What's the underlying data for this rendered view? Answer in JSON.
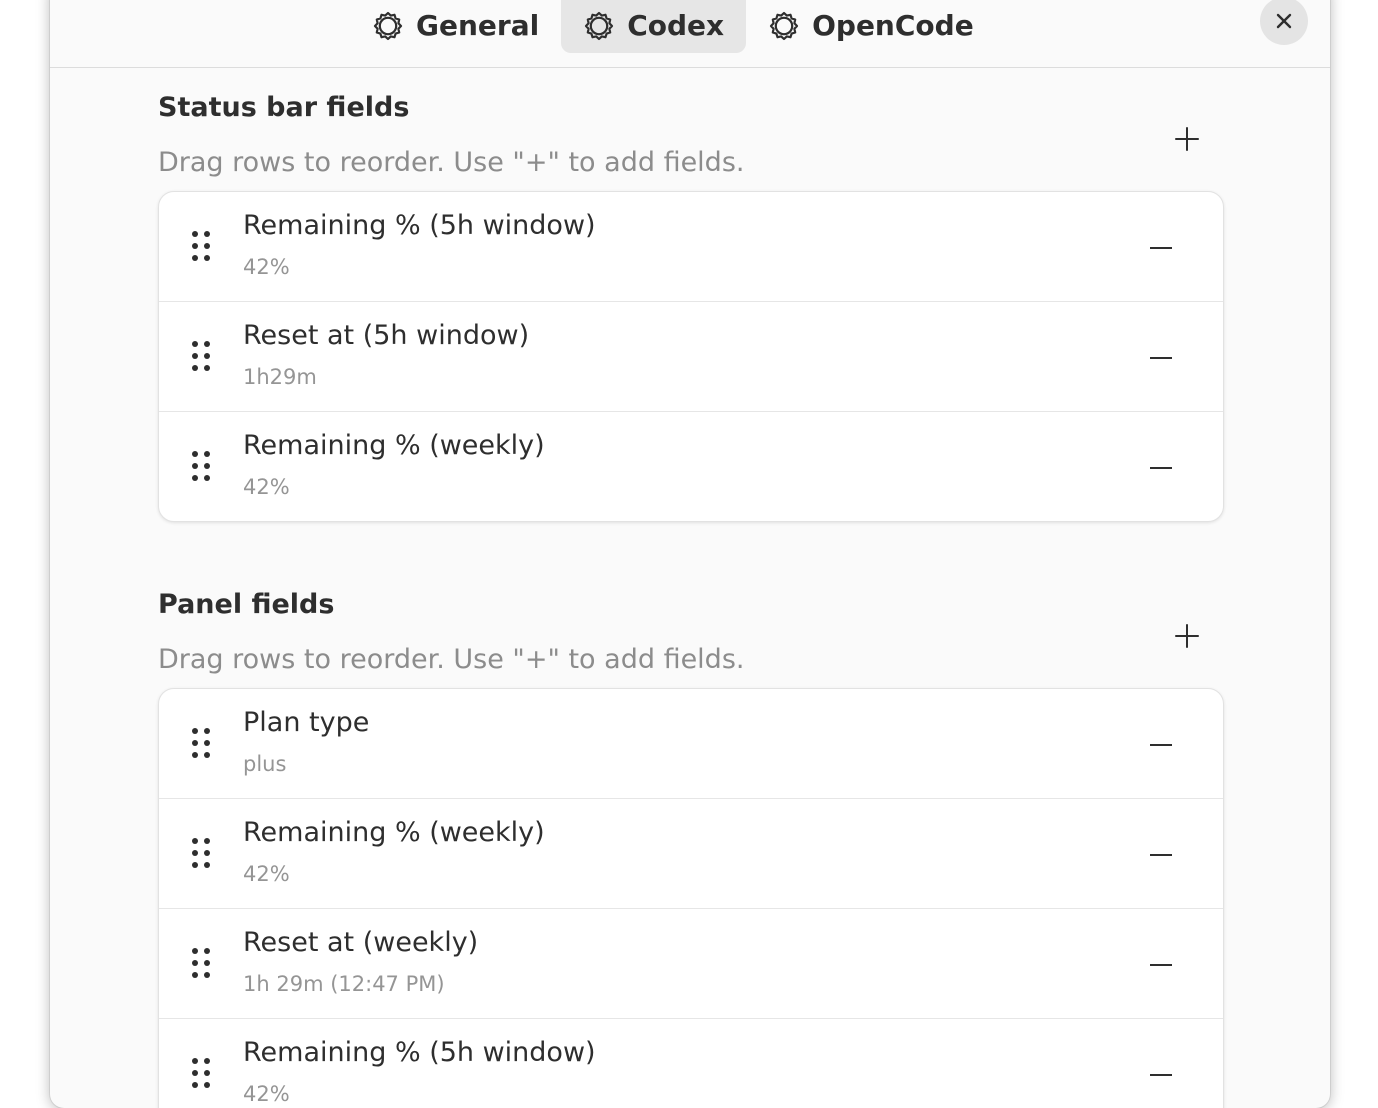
{
  "tabs": [
    {
      "label": "General",
      "icon": "gear-icon",
      "active": false
    },
    {
      "label": "Codex",
      "icon": "gear-icon",
      "active": true
    },
    {
      "label": "OpenCode",
      "icon": "gear-icon",
      "active": false
    }
  ],
  "close_icon": "close-icon",
  "sections": [
    {
      "title": "Status bar fields",
      "description": "Drag rows to reorder. Use \"+\" to add fields.",
      "add_icon": "plus-icon",
      "rows": [
        {
          "title": "Remaining % (5h window)",
          "value": "42%"
        },
        {
          "title": "Reset at (5h window)",
          "value": "1h29m"
        },
        {
          "title": "Remaining % (weekly)",
          "value": "42%"
        }
      ]
    },
    {
      "title": "Panel fields",
      "description": "Drag rows to reorder. Use \"+\" to add fields.",
      "add_icon": "plus-icon",
      "rows": [
        {
          "title": "Plan type",
          "value": "plus"
        },
        {
          "title": "Remaining % (weekly)",
          "value": "42%"
        },
        {
          "title": "Reset at (weekly)",
          "value": "1h 29m (12:47 PM)"
        },
        {
          "title": "Remaining % (5h window)",
          "value": "42%"
        }
      ]
    }
  ],
  "colors": {
    "window_bg": "#fafafa",
    "card_bg": "#ffffff",
    "active_tab_bg": "#e6e6e6",
    "text_primary": "#2e2e2e",
    "text_secondary": "#8c8c8c"
  }
}
